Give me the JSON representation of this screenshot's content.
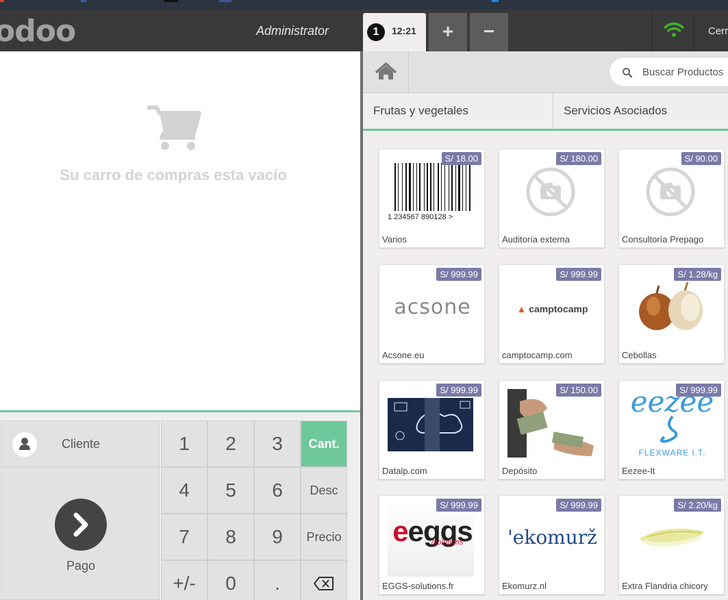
{
  "header": {
    "logo": "odoo",
    "username": "Administrator",
    "order_number": "1",
    "order_time": "12:21",
    "add_order": "+",
    "remove_order": "−",
    "close_label": "Cerr"
  },
  "cart": {
    "empty_message": "Su carro de compras esta vacío"
  },
  "actions": {
    "client": "Cliente",
    "payment": "Pago"
  },
  "keypad": {
    "k1": "1",
    "k2": "2",
    "k3": "3",
    "qty": "Cant.",
    "k4": "4",
    "k5": "5",
    "k6": "6",
    "disc": "Desc",
    "k7": "7",
    "k8": "8",
    "k9": "9",
    "price": "Precio",
    "plusminus": "+/-",
    "k0": "0",
    "dot": "."
  },
  "search": {
    "placeholder": "Buscar Productos"
  },
  "categories": [
    "Frutas y vegetales",
    "Servicios Asociados"
  ],
  "products": [
    {
      "name": "Varios",
      "price": "S/ 18.00"
    },
    {
      "name": "Auditoría externa",
      "price": "S/ 180.00"
    },
    {
      "name": "Consultoría Prepago",
      "price": "S/ 90.00"
    },
    {
      "name": "Acsone.eu",
      "price": "S/ 999.99"
    },
    {
      "name": "camptocamp.com",
      "price": "S/ 999.99"
    },
    {
      "name": "Cebollas",
      "price": "S/ 1.28/kg"
    },
    {
      "name": "Datalp.com",
      "price": "S/ 999.99"
    },
    {
      "name": "Depósito",
      "price": "S/ 150.00"
    },
    {
      "name": "Eezee-It",
      "price": "S/ 999.99"
    },
    {
      "name": "EGGS-solutions.fr",
      "price": "S/ 999.99"
    },
    {
      "name": "Ekomurz.nl",
      "price": "S/ 999.99"
    },
    {
      "name": "Extra Flandria chicory",
      "price": "S/ 2.20/kg"
    }
  ],
  "product_images": {
    "barcode_digits": "1 234567 890128 >",
    "acsone_logo": "acsone",
    "camptocamp_logo": "camptocamp",
    "eezee_logo": "eezee",
    "eezee_tagline": "FLEXWARE I.T.",
    "eggs_logo": "eggs",
    "eggs_sub": "/solutions",
    "ekomurz_logo": "'ekomurž"
  },
  "colors": {
    "accent": "#6ec89b",
    "header_bg": "#393939",
    "price_badge": "#7a7aa8"
  }
}
